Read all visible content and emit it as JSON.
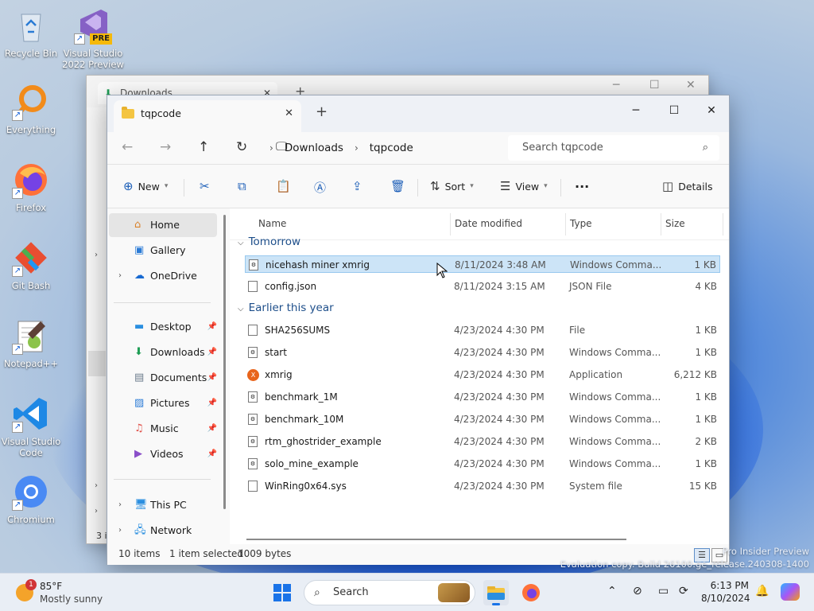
{
  "desktop": {
    "icons": [
      {
        "label": "Recycle Bin",
        "icon": "recycle-bin-icon"
      },
      {
        "label": "Visual Studio 2022 Preview",
        "icon": "visual-studio-icon",
        "badge": "PRE"
      },
      {
        "label": "Everything",
        "icon": "everything-search-icon"
      },
      {
        "label": "Firefox",
        "icon": "firefox-icon"
      },
      {
        "label": "Git Bash",
        "icon": "git-bash-icon"
      },
      {
        "label": "Notepad++",
        "icon": "notepad-plus-plus-icon"
      },
      {
        "label": "Visual Studio Code",
        "icon": "vscode-icon"
      },
      {
        "label": "Chromium",
        "icon": "chromium-icon"
      }
    ],
    "watermark_line1": "Pro Insider Preview",
    "watermark_line2": "Evaluation copy. Build 26100.ge_release.240308-1400"
  },
  "background_window": {
    "tab_title": "Downloads",
    "status_fragment": "3 i"
  },
  "window": {
    "tab_title": "tqpcode",
    "new_tab_symbol": "+",
    "close_tab_symbol": "✕",
    "controls": {
      "minimize": "─",
      "maximize": "☐",
      "close": "✕"
    },
    "breadcrumb": [
      "Downloads",
      "tqpcode"
    ],
    "search_placeholder": "Search tqpcode",
    "toolbar": {
      "new_label": "New",
      "sort_label": "Sort",
      "view_label": "View",
      "more_label": "···",
      "details_label": "Details"
    },
    "sidebar": {
      "items": [
        {
          "label": "Home",
          "icon": "home-icon",
          "selected": true
        },
        {
          "label": "Gallery",
          "icon": "gallery-icon"
        },
        {
          "label": "OneDrive",
          "icon": "onedrive-icon",
          "expandable": true
        },
        {
          "label": "Desktop",
          "icon": "desktop-icon",
          "pinned": true
        },
        {
          "label": "Downloads",
          "icon": "downloads-icon",
          "pinned": true
        },
        {
          "label": "Documents",
          "icon": "documents-icon",
          "pinned": true
        },
        {
          "label": "Pictures",
          "icon": "pictures-icon",
          "pinned": true
        },
        {
          "label": "Music",
          "icon": "music-icon",
          "pinned": true
        },
        {
          "label": "Videos",
          "icon": "videos-icon",
          "pinned": true
        },
        {
          "label": "This PC",
          "icon": "this-pc-icon",
          "expandable": true
        },
        {
          "label": "Network",
          "icon": "network-icon",
          "expandable": true
        }
      ]
    },
    "columns": [
      "Name",
      "Date modified",
      "Type",
      "Size"
    ],
    "groups": [
      {
        "label": "Tomorrow",
        "files": [
          {
            "name": "nicehash miner xmrig",
            "date": "8/11/2024 3:48 AM",
            "type": "Windows Comma...",
            "size": "1 KB",
            "selected": true
          },
          {
            "name": "config.json",
            "date": "8/11/2024 3:15 AM",
            "type": "JSON File",
            "size": "4 KB"
          }
        ]
      },
      {
        "label": "Earlier this year",
        "files": [
          {
            "name": "SHA256SUMS",
            "date": "4/23/2024 4:30 PM",
            "type": "File",
            "size": "1 KB"
          },
          {
            "name": "start",
            "date": "4/23/2024 4:30 PM",
            "type": "Windows Comma...",
            "size": "1 KB"
          },
          {
            "name": "xmrig",
            "date": "4/23/2024 4:30 PM",
            "type": "Application",
            "size": "6,212 KB",
            "app": true
          },
          {
            "name": "benchmark_1M",
            "date": "4/23/2024 4:30 PM",
            "type": "Windows Comma...",
            "size": "1 KB"
          },
          {
            "name": "benchmark_10M",
            "date": "4/23/2024 4:30 PM",
            "type": "Windows Comma...",
            "size": "1 KB"
          },
          {
            "name": "rtm_ghostrider_example",
            "date": "4/23/2024 4:30 PM",
            "type": "Windows Comma...",
            "size": "2 KB"
          },
          {
            "name": "solo_mine_example",
            "date": "4/23/2024 4:30 PM",
            "type": "Windows Comma...",
            "size": "1 KB"
          },
          {
            "name": "WinRing0x64.sys",
            "date": "4/23/2024 4:30 PM",
            "type": "System file",
            "size": "15 KB"
          }
        ]
      }
    ],
    "status": {
      "items": "10 items",
      "selected": "1 item selected",
      "size": "1009 bytes"
    }
  },
  "taskbar": {
    "weather_temp": "85°F",
    "weather_desc": "Mostly sunny",
    "weather_badge": "1",
    "search_label": "Search",
    "time": "6:13 PM",
    "date": "8/10/2024"
  },
  "colors": {
    "accent": "#1a73e8",
    "selection": "#cce4f7",
    "group_header": "#1d4e8a"
  }
}
